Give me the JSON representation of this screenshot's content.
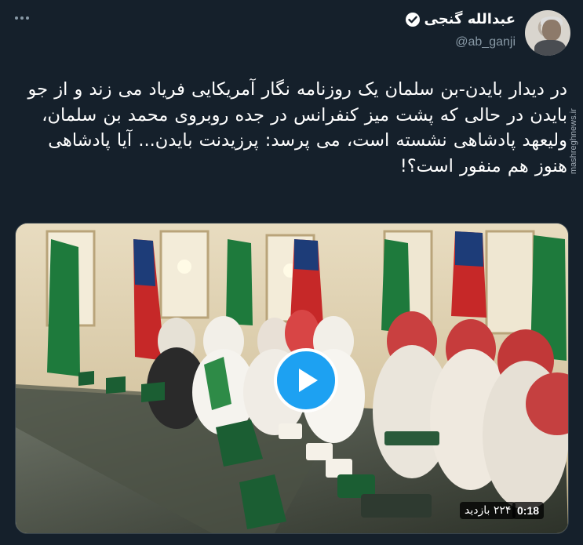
{
  "author": {
    "name": "عبدالله گنجی",
    "handle": "@ab_ganji",
    "verified": true
  },
  "watermark": "mashreghnews.ir",
  "tweet": {
    "text": "در دیدار بایدن-بن سلمان یک روزنامه نگار آمریکایی فریاد می زند و از جو بایدن در حالی که پشت میز کنفرانس در جده روبروی محمد بن سلمان، ولیعهد پادشاهی نشسته است، می پرسد: پرزیدنت بایدن... آیا پادشاهی هنوز هم منفور است؟!"
  },
  "video": {
    "duration": "0:18",
    "views": "۲۲۴ بازدید"
  },
  "icons": {
    "more": "more-options-icon",
    "verified": "verified-badge-icon",
    "play": "play-icon"
  },
  "colors": {
    "background": "#15202b",
    "accent": "#1da1f2",
    "muted": "#8899a6"
  }
}
